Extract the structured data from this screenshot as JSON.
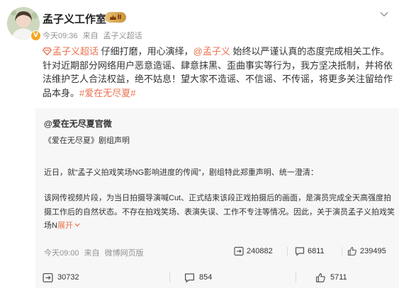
{
  "author": {
    "name": "孟子义工作室",
    "vip_level": "Ⅱ",
    "verified": true,
    "time": "今天09:36",
    "source_prefix": "来自",
    "source": "孟子义超话"
  },
  "post": {
    "supertopic": "孟子义超话",
    "text_1": " 仔细打磨，用心演绎，",
    "mention": "@孟子义",
    "text_2": " 始终以严谨认真的态度完成相关工作。针对近期部分网络用户恶意造谣、肆意抹黑、歪曲事实等行为，我方坚决抵制，并将依法维护艺人合法权益，绝不姑息！望大家不造谣、不信谣、不传谣，将更多关注留给作品本身。",
    "hashtag": "#爱在无尽夏#"
  },
  "quote": {
    "author": "@爱在无尽夏官微",
    "title": "《爱在无尽夏》剧组声明",
    "para_1": "近日，就“孟子义拍戏笑场NG影响进度的传闻”，剧组特此郑重声明、统一澄清：",
    "para_2": "该网传视频片段，为当日拍摄导演喊Cut、正式结束该段正戏拍摄后的画面，是演员完成全天高强度拍摄工作后的自然状态。不存在拍戏笑场、表演失误、工作不专注等情况。因此，关于演员孟子义拍戏笑场N",
    "expand_label": "展开",
    "time": "今天09:00",
    "source_prefix": "来自",
    "source": "微博网页版",
    "reposts": "240882",
    "comments": "6811",
    "likes": "239495"
  },
  "footer": {
    "reposts": "30732",
    "comments": "854",
    "likes": "5711"
  },
  "colors": {
    "link": "#eb7350",
    "meta_text": "#939393",
    "quote_bg": "#f7f7f7"
  }
}
